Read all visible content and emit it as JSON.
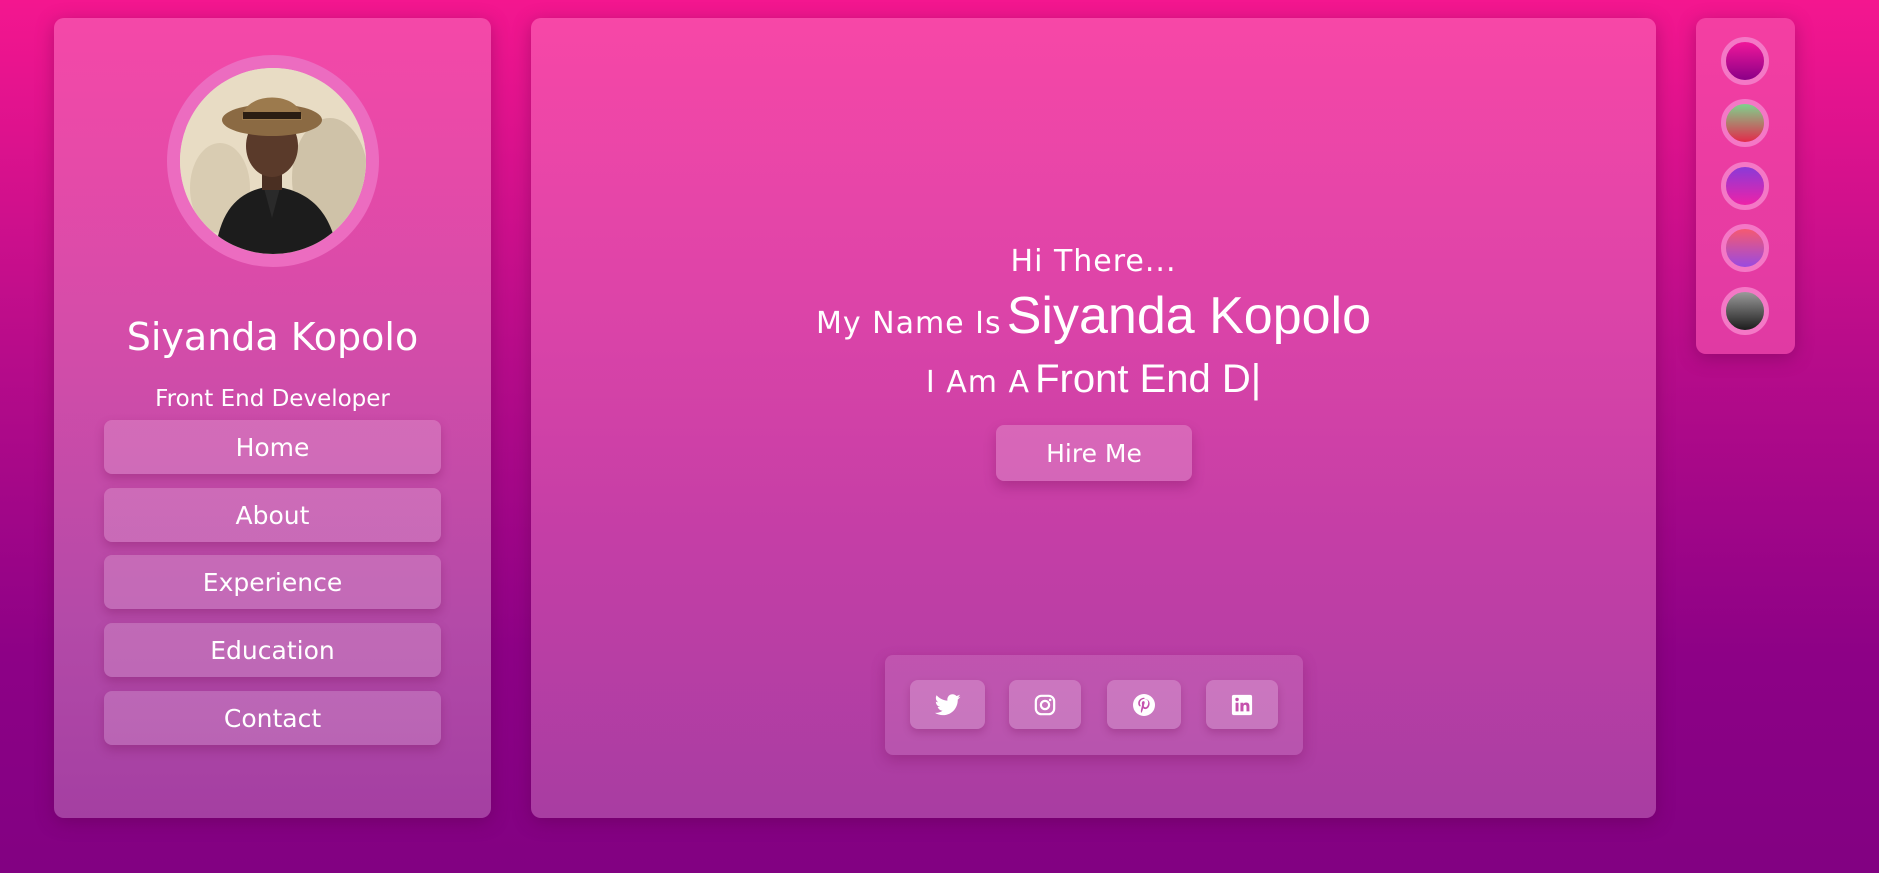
{
  "profile": {
    "name": "Siyanda Kopolo",
    "role": "Front End Developer",
    "avatar_icon": "avatar-photo"
  },
  "nav": {
    "items": [
      {
        "label": "Home"
      },
      {
        "label": "About"
      },
      {
        "label": "Experience"
      },
      {
        "label": "Education"
      },
      {
        "label": "Contact"
      }
    ]
  },
  "hero": {
    "greeting": "Hi There...",
    "name_prefix": "My Name Is",
    "name": "Siyanda Kopolo",
    "role_prefix": "I Am A",
    "typed_role": "Front End D|",
    "hire_label": "Hire Me"
  },
  "social": {
    "icons": [
      "twitter-icon",
      "instagram-icon",
      "pinterest-icon",
      "linkedin-icon"
    ]
  },
  "themes": {
    "swatches": [
      {
        "name": "theme-pink-purple",
        "colors": [
          "#f0179a",
          "#8a0087"
        ]
      },
      {
        "name": "theme-green-red",
        "colors": [
          "#7ed38d",
          "#e32a4a"
        ]
      },
      {
        "name": "theme-violet-pink",
        "colors": [
          "#8a3ad8",
          "#ee22a8"
        ]
      },
      {
        "name": "theme-coral-purple",
        "colors": [
          "#f55a71",
          "#9a4ae0"
        ]
      },
      {
        "name": "theme-gray-black",
        "colors": [
          "#9a9a9a",
          "#1c1c1c"
        ]
      }
    ]
  },
  "colors": {
    "background_top": "#f4168f",
    "background_bottom": "#820182",
    "text": "#ffffff"
  }
}
